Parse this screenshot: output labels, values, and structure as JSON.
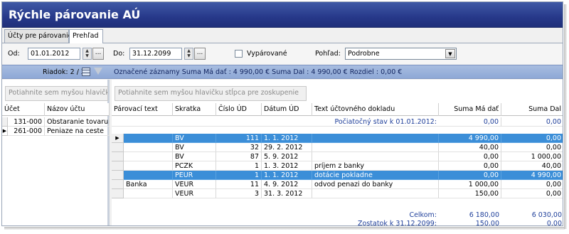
{
  "window": {
    "title": "Rýchle párovanie AÚ"
  },
  "tabs": [
    {
      "label": "Účty pre párovanie"
    },
    {
      "label": "Prehľad"
    }
  ],
  "filters": {
    "od_label": "Od:",
    "od_value": "01.01.2012",
    "do_label": "Do:",
    "do_value": "31.12.2099",
    "browse_label": "...",
    "vyparovane_label": "Vypárované",
    "pohlad_label": "Pohľad:",
    "pohlad_value": "Podrobne"
  },
  "info": {
    "riadok": "Riadok: 2 / 2",
    "summary": "Označené záznamy Suma Má dať : 4 990,00 €  Suma Dal : 4 990,00 €  Rozdiel : 0,00 €"
  },
  "left_grid": {
    "group_hint": "Potiahnite sem myšou hlavičku",
    "columns": [
      "Účet",
      "Názov účtu"
    ],
    "rows": [
      {
        "ucet": "131-000",
        "nazov": "Obstaranie tovaru",
        "indicator": ""
      },
      {
        "ucet": "261-000",
        "nazov": "Peniaze na ceste",
        "indicator": "▶"
      }
    ]
  },
  "right_grid": {
    "group_hint": "Potiahnite sem myšou hlavičku stĺpca pre zoskupenie",
    "columns": [
      "Párovací text",
      "Skratka",
      "Číslo ÚD",
      "Dátum ÚD",
      "Text účtovného dokladu",
      "Suma Má dať",
      "Suma Dal"
    ],
    "opening": {
      "label": "Počiatočný stav k 01.01.2012:",
      "md": "0,00",
      "d": "0,00"
    },
    "rows": [
      {
        "indicator": "▶",
        "parovaci": "",
        "skratka": "BV",
        "cislo": "111",
        "datum": "1. 1. 2012",
        "text": "",
        "md": "4 990,00",
        "d": "0,00",
        "selected": true
      },
      {
        "indicator": "",
        "parovaci": "",
        "skratka": "BV",
        "cislo": "32",
        "datum": "29. 2. 2012",
        "text": "",
        "md": "40,00",
        "d": "0,00",
        "selected": false
      },
      {
        "indicator": "",
        "parovaci": "",
        "skratka": "BV",
        "cislo": "87",
        "datum": "5. 9. 2012",
        "text": "",
        "md": "0,00",
        "d": "1 000,00",
        "selected": false
      },
      {
        "indicator": "",
        "parovaci": "",
        "skratka": "PCZK",
        "cislo": "1",
        "datum": "1. 3. 2012",
        "text": "príjem z banky",
        "md": "0,00",
        "d": "40,00",
        "selected": false
      },
      {
        "indicator": "",
        "parovaci": "",
        "skratka": "PEUR",
        "cislo": "1",
        "datum": "1. 1. 2012",
        "text": "dotácie pokladne",
        "md": "0,00",
        "d": "4 990,00",
        "selected": true
      },
      {
        "indicator": "",
        "parovaci": "Banka",
        "skratka": "VEUR",
        "cislo": "11",
        "datum": "4. 9. 2012",
        "text": "odvod penazi do banky",
        "md": "1 000,00",
        "d": "0,00",
        "selected": false
      },
      {
        "indicator": "",
        "parovaci": "",
        "skratka": "VEUR",
        "cislo": "3",
        "datum": "31. 3. 2012",
        "text": "",
        "md": "150,00",
        "d": "0,00",
        "selected": false
      }
    ],
    "celkom": {
      "label": "Celkom:",
      "md": "6 180,00",
      "d": "6 030,00"
    },
    "zostatok": {
      "label": "Zostatok k 31.12.2099:",
      "md": "150,00",
      "d": "0,00"
    }
  }
}
